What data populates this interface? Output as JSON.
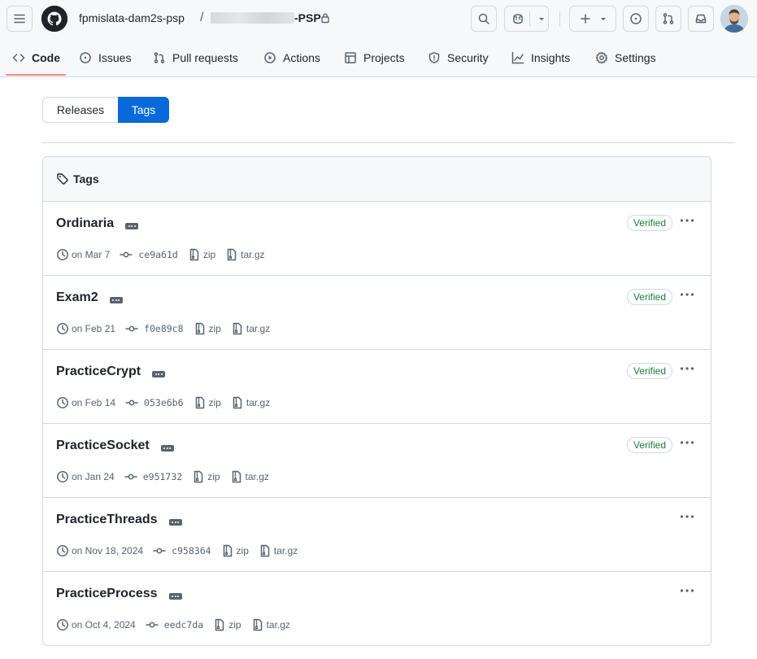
{
  "header": {
    "owner": "fpmislata-dam2s-psp",
    "separator": "/",
    "repo_suffix": "-PSP",
    "icons": [
      "hamburger-icon",
      "github-logo",
      "lock-icon",
      "search-icon",
      "copilot-icon",
      "chevron-down-icon",
      "plus-icon",
      "issue-icon",
      "pull-request-icon",
      "inbox-icon",
      "avatar"
    ]
  },
  "nav": {
    "tabs": [
      {
        "label": "Code",
        "icon": "code-icon"
      },
      {
        "label": "Issues",
        "icon": "issue-icon"
      },
      {
        "label": "Pull requests",
        "icon": "pull-request-icon"
      },
      {
        "label": "Actions",
        "icon": "play-icon"
      },
      {
        "label": "Projects",
        "icon": "table-icon"
      },
      {
        "label": "Security",
        "icon": "shield-icon"
      },
      {
        "label": "Insights",
        "icon": "graph-icon"
      },
      {
        "label": "Settings",
        "icon": "gear-icon"
      }
    ],
    "active": "Code"
  },
  "toggle": {
    "releases": "Releases",
    "tags": "Tags",
    "selected": "Tags"
  },
  "box": {
    "title": "Tags",
    "tags": [
      {
        "name": "Ordinaria",
        "date": "on Mar 7",
        "sha": "ce9a61d",
        "zip": "zip",
        "tar": "tar.gz",
        "verified": "Verified"
      },
      {
        "name": "Exam2",
        "date": "on Feb 21",
        "sha": "f0e89c8",
        "zip": "zip",
        "tar": "tar.gz",
        "verified": "Verified"
      },
      {
        "name": "PracticeCrypt",
        "date": "on Feb 14",
        "sha": "053e6b6",
        "zip": "zip",
        "tar": "tar.gz",
        "verified": "Verified"
      },
      {
        "name": "PracticeSocket",
        "date": "on Jan 24",
        "sha": "e951732",
        "zip": "zip",
        "tar": "tar.gz",
        "verified": "Verified"
      },
      {
        "name": "PracticeThreads",
        "date": "on Nov 18, 2024",
        "sha": "c958364",
        "zip": "zip",
        "tar": "tar.gz",
        "verified": ""
      },
      {
        "name": "PracticeProcess",
        "date": "on Oct 4, 2024",
        "sha": "eedc7da",
        "zip": "zip",
        "tar": "tar.gz",
        "verified": ""
      }
    ]
  },
  "colors": {
    "accent": "#0969da",
    "underline": "#fd8c73",
    "verified": "#1a7f37"
  }
}
